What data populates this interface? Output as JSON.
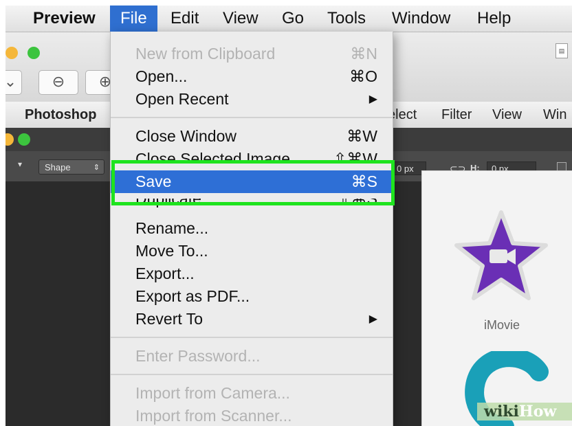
{
  "menubar": {
    "app": "Preview",
    "items": [
      "File",
      "Edit",
      "View",
      "Go",
      "Tools",
      "Window",
      "Help"
    ]
  },
  "photoshop_menubar": {
    "app": "Photoshop",
    "items": [
      "elect",
      "Filter",
      "View",
      "Win"
    ]
  },
  "photoshop_options": {
    "shape_dropdown": "Shape",
    "w_value": "0 px",
    "h_label": "H:",
    "h_value": "0 px"
  },
  "apps_panel": {
    "app_label": "iMovie"
  },
  "file_menu": {
    "new_from_clipboard": {
      "label": "New from Clipboard",
      "shortcut": "⌘N"
    },
    "open": {
      "label": "Open...",
      "shortcut": "⌘O"
    },
    "open_recent": {
      "label": "Open Recent"
    },
    "close_window": {
      "label": "Close Window",
      "shortcut": "⌘W"
    },
    "close_selected_image": {
      "label": "Close Selected Image",
      "shortcut": "⇧⌘W"
    },
    "save": {
      "label": "Save",
      "shortcut": "⌘S"
    },
    "duplicate": {
      "label": "Duplicate",
      "shortcut": "⇧⌘S"
    },
    "rename": {
      "label": "Rename..."
    },
    "move_to": {
      "label": "Move To..."
    },
    "export": {
      "label": "Export..."
    },
    "export_pdf": {
      "label": "Export as PDF..."
    },
    "revert_to": {
      "label": "Revert To"
    },
    "enter_password": {
      "label": "Enter Password..."
    },
    "import_camera": {
      "label": "Import from Camera..."
    },
    "import_scanner": {
      "label": "Import from Scanner..."
    }
  },
  "watermark": {
    "part1": "wiki",
    "part2": "How"
  },
  "colors": {
    "highlight": "#2e6fd6",
    "annotation_box": "#1ee31e"
  }
}
